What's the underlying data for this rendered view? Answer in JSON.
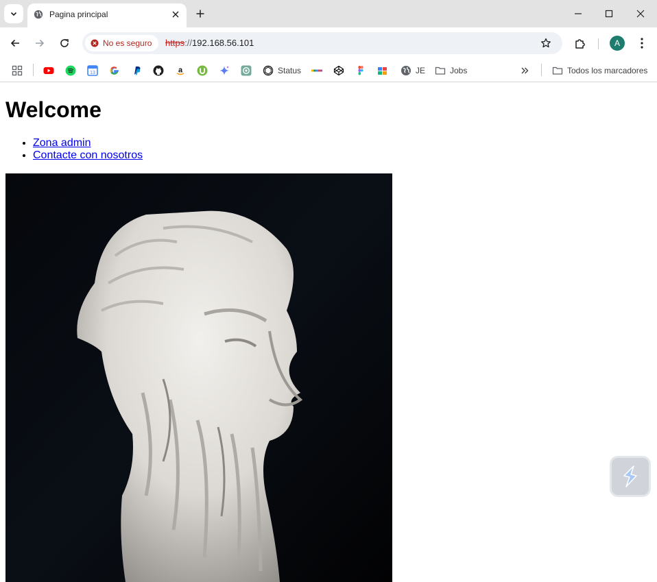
{
  "tab": {
    "title": "Pagina principal"
  },
  "address": {
    "security_label": "No es seguro",
    "scheme": "https",
    "separator": "://",
    "host": "192.168.56.101"
  },
  "bookmarks": {
    "items": [
      {
        "label": "Status"
      },
      {
        "label": "JE"
      },
      {
        "label": "Jobs"
      }
    ],
    "all_bookmarks_label": "Todos los marcadores"
  },
  "profile": {
    "initial": "A"
  },
  "page": {
    "heading": "Welcome",
    "links": [
      "Zona admin",
      "Contacte con nosotros"
    ]
  }
}
